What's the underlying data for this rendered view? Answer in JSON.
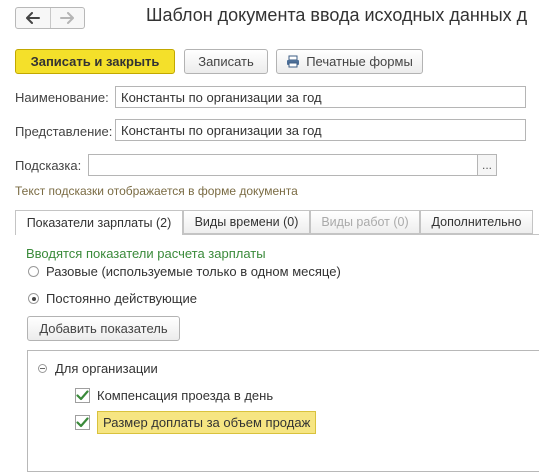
{
  "window": {
    "title": "Шаблон документа ввода исходных данных д"
  },
  "toolbar": {
    "save_close_label": "Записать и закрыть",
    "save_label": "Записать",
    "print_forms_label": "Печатные формы",
    "print_icon": "printer-icon"
  },
  "form": {
    "name_label": "Наименование:",
    "name_value": "Константы по организации за год",
    "presentation_label": "Представление:",
    "presentation_value": "Константы по организации за год",
    "hint_label": "Подсказка:",
    "hint_value": "",
    "hint_button": "...",
    "hint_note": "Текст подсказки отображается в форме документа"
  },
  "tabs": [
    {
      "label": "Показатели зарплаты (2)",
      "active": true,
      "enabled": true
    },
    {
      "label": "Виды времени (0)",
      "active": false,
      "enabled": true
    },
    {
      "label": "Виды работ (0)",
      "active": false,
      "enabled": false
    },
    {
      "label": "Дополнительно",
      "active": false,
      "enabled": true
    }
  ],
  "panel": {
    "heading": "Вводятся показатели расчета зарплаты",
    "radio_options": [
      {
        "label": "Разовые (используемые только в одном месяце)",
        "checked": false
      },
      {
        "label": "Постоянно действующие",
        "checked": true
      }
    ],
    "add_button_label": "Добавить показатель"
  },
  "tree": {
    "group_label": "Для организации",
    "items": [
      {
        "label": "Компенсация проезда в день",
        "checked": true,
        "highlighted": false
      },
      {
        "label": "Размер доплаты за объем продаж",
        "checked": true,
        "highlighted": true
      }
    ]
  },
  "colors": {
    "primary_button": "#f4e02a",
    "check_green": "#3a8a3a",
    "hint_text": "#7a6b43",
    "highlight": "#f6e582"
  }
}
